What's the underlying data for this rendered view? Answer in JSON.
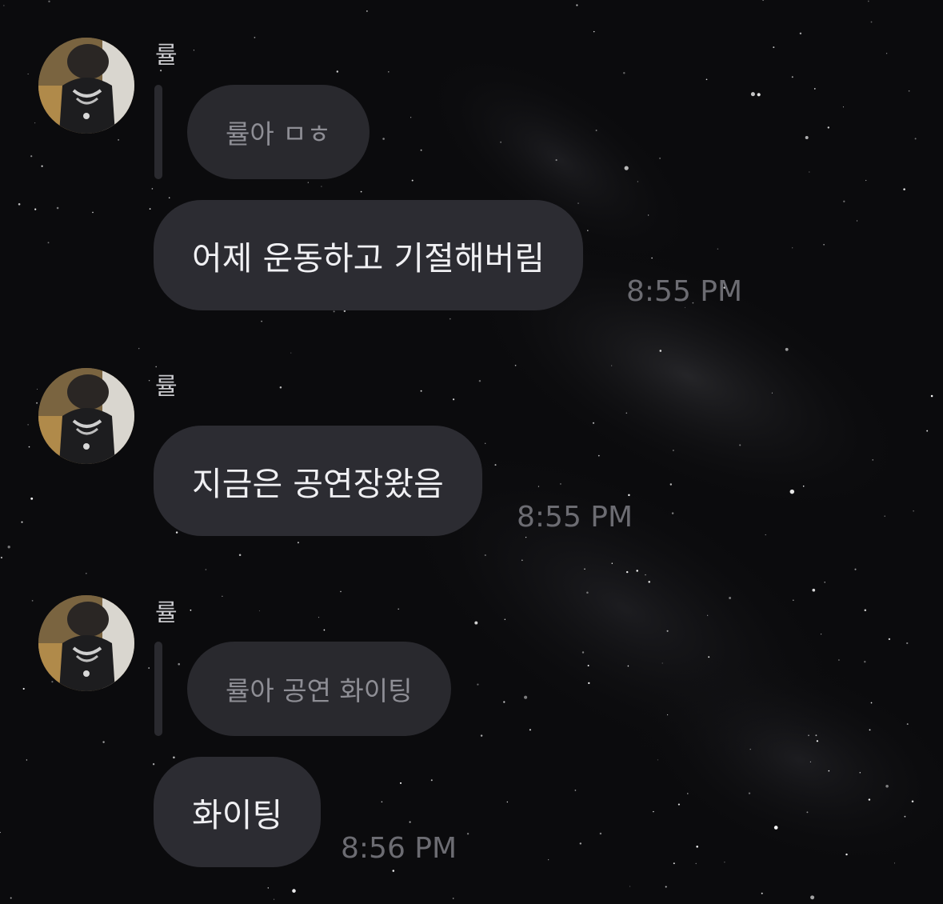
{
  "chat": {
    "groups": [
      {
        "sender": "률",
        "quote": "률아 ㅁㅎ",
        "message": "어제 운동하고 기절해버림",
        "time": "8:55 PM"
      },
      {
        "sender": "률",
        "message": "지금은 공연장왔음",
        "time": "8:55 PM"
      },
      {
        "sender": "률",
        "quote": "률아 공연 화이팅",
        "message": "화이팅",
        "time": "8:56 PM"
      }
    ]
  },
  "colors": {
    "background": "#0c0c0e",
    "bubble": "#2c2c32",
    "quote_bubble": "#29292e",
    "message_text": "#f0f0f3",
    "quote_text": "#8e8e95",
    "timestamp": "#6c6c72",
    "sender_name": "#c9c9cd"
  }
}
